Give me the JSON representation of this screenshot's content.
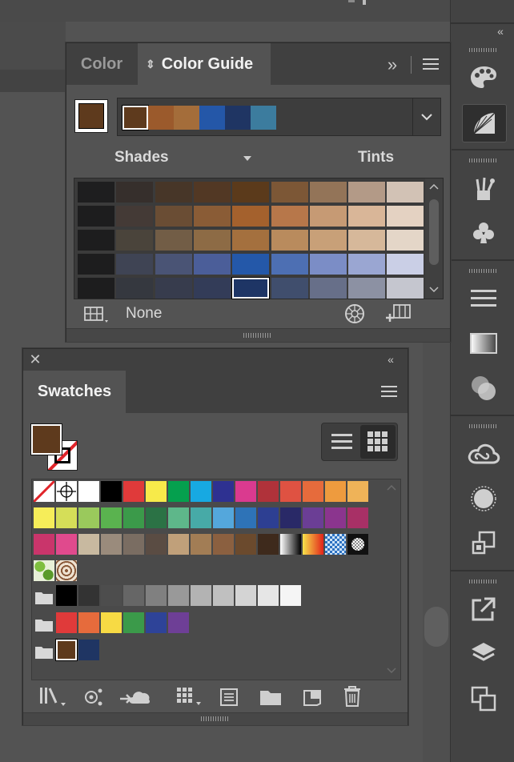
{
  "color_guide_panel": {
    "tab_color": "Color",
    "tab_color_guide": "Color Guide",
    "current_color": "#5e3a1d",
    "harmony_colors": [
      "#5e3a1d",
      "#9b5a2c",
      "#a46d3a",
      "#2457a8",
      "#1f3563",
      "#3c7c9e"
    ],
    "label_shades": "Shades",
    "label_tints": "Tints",
    "variation_grid": [
      [
        "#1e1e1f",
        "#362f2c",
        "#473628",
        "#523824",
        "#5b3a1b",
        "#7c5736",
        "#937458",
        "#b39a87",
        "#d2c2b5"
      ],
      [
        "#1d1d1e",
        "#443a36",
        "#6a4d34",
        "#8a5c36",
        "#a4612d",
        "#b7774a",
        "#c69a74",
        "#d9b698",
        "#e4d2c2"
      ],
      [
        "#1d1d1e",
        "#4a443b",
        "#725d46",
        "#8d6b45",
        "#a4703e",
        "#b98b5d",
        "#c8a078",
        "#d6b89a",
        "#e4d6c8"
      ],
      [
        "#1d1d1e",
        "#3f4454",
        "#4a5475",
        "#4b5e99",
        "#2458a9",
        "#4d6fb3",
        "#7b8dc6",
        "#9aa6d2",
        "#cacfe6"
      ],
      [
        "#1d1d1e",
        "#35383f",
        "#373c4d",
        "#333c58",
        "#1e3565",
        "#404e6d",
        "#676f89",
        "#8c91a3",
        "#c5c6cf"
      ]
    ],
    "selected_cell": [
      4,
      4
    ],
    "label_none": "None"
  },
  "swatches_panel": {
    "tab_swatches": "Swatches",
    "fill_color": "#5e3a1d",
    "rows": [
      [
        "none",
        "registration",
        "#ffffff",
        "#000000",
        "#e03a3a",
        "#f7ea4a",
        "#05a04e",
        "#17a9e2",
        "#2e3191",
        "#da3a8f",
        "#b0323a",
        "#df5242",
        "#e66b3c",
        "#ee9b3e",
        "#efb358"
      ],
      [
        "#f6ed59",
        "#d5de58",
        "#9ac95c",
        "#5ab34f",
        "#3b9a4a",
        "#2b7245",
        "#5eb78a",
        "#47aaa7",
        "#54a7dc",
        "#2e73b7",
        "#2d3f92",
        "#292967",
        "#6b3e95",
        "#8b358e",
        "#a83066"
      ],
      [
        "#c9356b",
        "#e04a8d",
        "#c8b9a0",
        "#9a8b7c",
        "#7a6d62",
        "#5a4c43",
        "#c0a07a",
        "#a27d55",
        "#8b6040",
        "#6b4a2d",
        "#3e2a1c",
        "grad-gray",
        "grad-orange",
        "pattern-blue",
        "pattern-dots"
      ],
      [
        "pattern-leaf",
        "pattern-swirl"
      ]
    ],
    "group_rows": [
      [
        "#000000",
        "#333333",
        "#4d4d4d",
        "#666666",
        "#808080",
        "#999999",
        "#b3b3b3",
        "#c0c0c0",
        "#d4d4d4",
        "#e6e6e6",
        "#f5f5f5"
      ],
      [
        "#e03a3a",
        "#e66b3c",
        "#f7da44",
        "#3b9a4a",
        "#2e4398",
        "#6e3f96"
      ],
      [
        "#5e3a1d",
        "#1f3563"
      ]
    ]
  }
}
